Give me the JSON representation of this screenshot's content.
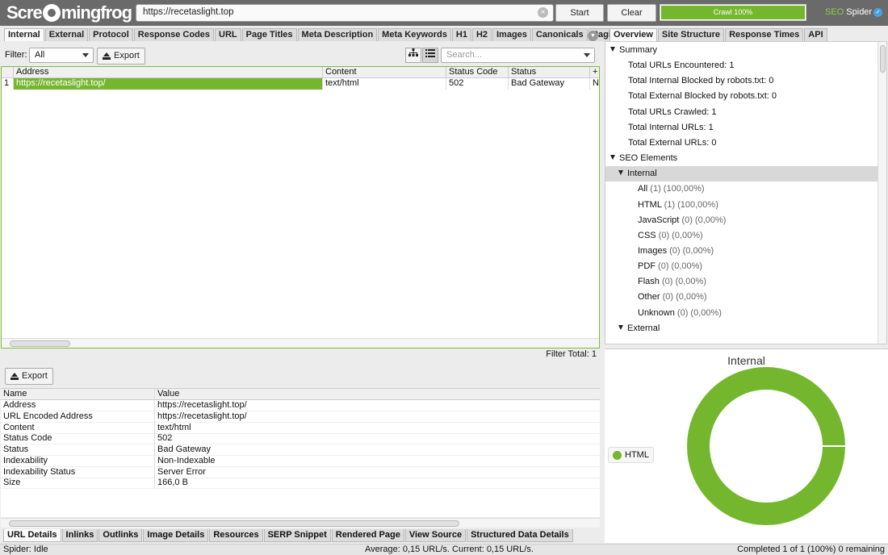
{
  "topbar": {
    "logo_left": "Scre",
    "logo_right": "mingfrog",
    "url": "https://recetaslight.top",
    "clear_glyph": "×",
    "start_label": "Start",
    "clear_label": "Clear",
    "progress_label": "Crawl 100%",
    "progress_fraction": 1.0,
    "brand_seo": "SEO",
    "brand_spider": " Spider",
    "accent_color": "#74b72e"
  },
  "left_tabs": [
    {
      "label": "Internal",
      "active": true
    },
    {
      "label": "External",
      "active": false
    },
    {
      "label": "Protocol",
      "active": false
    },
    {
      "label": "Response Codes",
      "active": false
    },
    {
      "label": "URL",
      "active": false
    },
    {
      "label": "Page Titles",
      "active": false
    },
    {
      "label": "Meta Description",
      "active": false
    },
    {
      "label": "Meta Keywords",
      "active": false
    },
    {
      "label": "H1",
      "active": false
    },
    {
      "label": "H2",
      "active": false
    },
    {
      "label": "Images",
      "active": false
    },
    {
      "label": "Canonicals",
      "active": false
    },
    {
      "label": "Paginatio",
      "active": false
    }
  ],
  "filter": {
    "label": "Filter:",
    "value": "All",
    "export_label": "Export",
    "search_placeholder": "Search..."
  },
  "grid": {
    "columns": [
      "Address",
      "Content",
      "Status Code",
      "Status",
      "+"
    ],
    "rows": [
      {
        "num": "1",
        "address": "https://recetaslight.top/",
        "content": "text/html",
        "status_code": "502",
        "status": "Bad Gateway",
        "extra": "N"
      }
    ],
    "filter_total": "Filter Total:  1"
  },
  "details": {
    "export_label": "Export",
    "columns": [
      "Name",
      "Value"
    ],
    "rows": [
      {
        "name": "Address",
        "value": "https://recetaslight.top/"
      },
      {
        "name": "URL Encoded Address",
        "value": "https://recetaslight.top/"
      },
      {
        "name": "Content",
        "value": "text/html"
      },
      {
        "name": "Status Code",
        "value": "502"
      },
      {
        "name": "Status",
        "value": "Bad Gateway"
      },
      {
        "name": "Indexability",
        "value": "Non-Indexable"
      },
      {
        "name": "Indexability Status",
        "value": "Server Error"
      },
      {
        "name": "Size",
        "value": "166,0 B"
      }
    ]
  },
  "bottom_tabs": [
    {
      "label": "URL Details",
      "active": true
    },
    {
      "label": "Inlinks",
      "active": false
    },
    {
      "label": "Outlinks",
      "active": false
    },
    {
      "label": "Image Details",
      "active": false
    },
    {
      "label": "Resources",
      "active": false
    },
    {
      "label": "SERP Snippet",
      "active": false
    },
    {
      "label": "Rendered Page",
      "active": false
    },
    {
      "label": "View Source",
      "active": false
    },
    {
      "label": "Structured Data Details",
      "active": false
    }
  ],
  "right_tabs": [
    {
      "label": "Overview",
      "active": true
    },
    {
      "label": "Site Structure",
      "active": false
    },
    {
      "label": "Response Times",
      "active": false
    },
    {
      "label": "API",
      "active": false
    }
  ],
  "tree": [
    {
      "label": "Summary",
      "count": "",
      "level": 0,
      "toggle": true,
      "selected": false
    },
    {
      "label": "Total URLs Encountered: 1",
      "count": "",
      "level": 1,
      "toggle": false,
      "selected": false
    },
    {
      "label": "Total Internal Blocked by robots.txt: 0",
      "count": "",
      "level": 1,
      "toggle": false,
      "selected": false
    },
    {
      "label": "Total External Blocked by robots.txt: 0",
      "count": "",
      "level": 1,
      "toggle": false,
      "selected": false
    },
    {
      "label": "Total URLs Crawled: 1",
      "count": "",
      "level": 1,
      "toggle": false,
      "selected": false
    },
    {
      "label": "Total Internal URLs: 1",
      "count": "",
      "level": 1,
      "toggle": false,
      "selected": false
    },
    {
      "label": "Total External URLs: 0",
      "count": "",
      "level": 1,
      "toggle": false,
      "selected": false
    },
    {
      "label": "SEO Elements",
      "count": "",
      "level": 0,
      "toggle": true,
      "selected": false
    },
    {
      "label": "Internal",
      "count": "",
      "level": 1,
      "toggle": true,
      "selected": true
    },
    {
      "label": "All",
      "count": " (1) (100,00%)",
      "level": 2,
      "toggle": false,
      "selected": false
    },
    {
      "label": "HTML",
      "count": " (1) (100,00%)",
      "level": 2,
      "toggle": false,
      "selected": false
    },
    {
      "label": "JavaScript",
      "count": " (0) (0,00%)",
      "level": 2,
      "toggle": false,
      "selected": false
    },
    {
      "label": "CSS",
      "count": " (0) (0,00%)",
      "level": 2,
      "toggle": false,
      "selected": false
    },
    {
      "label": "Images",
      "count": " (0) (0,00%)",
      "level": 2,
      "toggle": false,
      "selected": false
    },
    {
      "label": "PDF",
      "count": " (0) (0,00%)",
      "level": 2,
      "toggle": false,
      "selected": false
    },
    {
      "label": "Flash",
      "count": " (0) (0,00%)",
      "level": 2,
      "toggle": false,
      "selected": false
    },
    {
      "label": "Other",
      "count": " (0) (0,00%)",
      "level": 2,
      "toggle": false,
      "selected": false
    },
    {
      "label": "Unknown",
      "count": " (0) (0,00%)",
      "level": 2,
      "toggle": false,
      "selected": false
    },
    {
      "label": "External",
      "count": "",
      "level": 1,
      "toggle": true,
      "selected": false
    }
  ],
  "chart_data": {
    "type": "pie",
    "title": "Internal",
    "categories": [
      "HTML"
    ],
    "values": [
      1
    ],
    "colors": [
      "#74b72e"
    ],
    "legend": "left"
  },
  "status": {
    "left": "Spider: Idle",
    "center": "Average: 0,15 URL/s. Current: 0,15 URL/s.",
    "right": "Completed 1 of 1 (100%) 0 remaining"
  }
}
